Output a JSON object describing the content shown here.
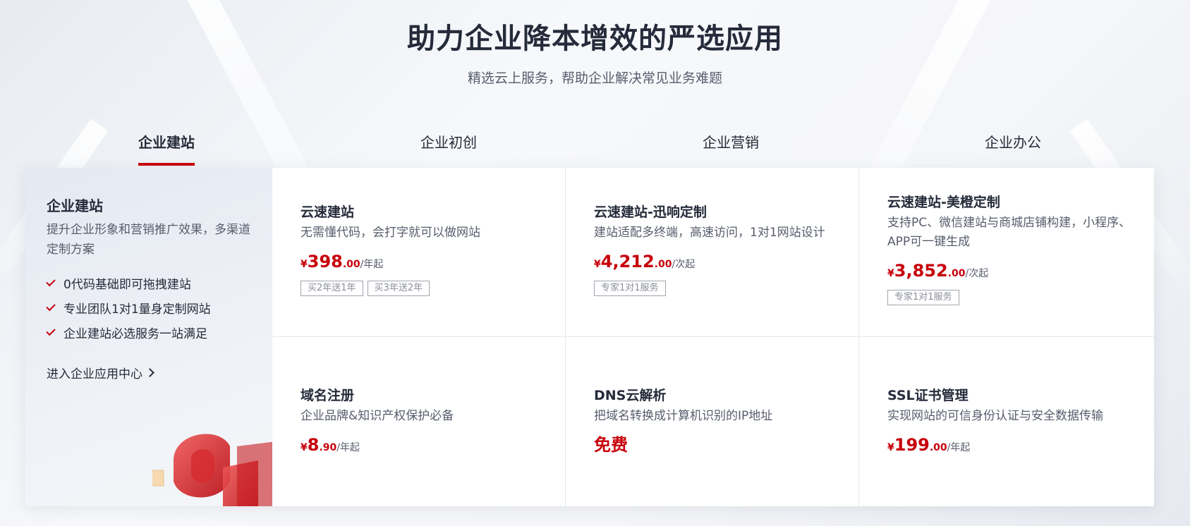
{
  "hero": {
    "title": "助力企业降本增效的严选应用",
    "subtitle": "精选云上服务，帮助企业解决常见业务难题"
  },
  "tabs": [
    {
      "label": "企业建站",
      "active": true
    },
    {
      "label": "企业初创",
      "active": false
    },
    {
      "label": "企业营销",
      "active": false
    },
    {
      "label": "企业办公",
      "active": false
    }
  ],
  "side": {
    "title": "企业建站",
    "description": "提升企业形象和营销推广效果，多渠道定制方案",
    "features": [
      "0代码基础即可拖拽建站",
      "专业团队1对1量身定制网站",
      "企业建站必选服务一站满足"
    ],
    "link_label": "进入企业应用中心"
  },
  "products": [
    {
      "title": "云速建站",
      "description": "无需懂代码，会打字就可以做网站",
      "currency": "¥",
      "price_int": "398",
      "price_dec": ".00",
      "unit": "/年起",
      "tags": [
        "买2年送1年",
        "买3年送2年"
      ]
    },
    {
      "title": "云速建站-迅响定制",
      "description": "建站适配多终端，高速访问，1对1网站设计",
      "currency": "¥",
      "price_int": "4,212",
      "price_dec": ".00",
      "unit": "/次起",
      "tags": [
        "专家1对1服务"
      ]
    },
    {
      "title": "云速建站-美橙定制",
      "description": "支持PC、微信建站与商城店铺构建，小程序、APP可一键生成",
      "currency": "¥",
      "price_int": "3,852",
      "price_dec": ".00",
      "unit": "/次起",
      "tags": [
        "专家1对1服务"
      ]
    },
    {
      "title": "域名注册",
      "description": "企业品牌&知识产权保护必备",
      "currency": "¥",
      "price_int": "8",
      "price_dec": ".90",
      "unit": "/年起",
      "tags": []
    },
    {
      "title": "DNS云解析",
      "description": "把域名转换成计算机识别的IP地址",
      "free_label": "免费",
      "tags": []
    },
    {
      "title": "SSL证书管理",
      "description": "实现网站的可信身份认证与安全数据传输",
      "currency": "¥",
      "price_int": "199",
      "price_dec": ".00",
      "unit": "/年起",
      "tags": []
    }
  ],
  "colors": {
    "accent": "#c7000b",
    "text_primary": "#252b3a",
    "text_secondary": "#575d6c"
  }
}
